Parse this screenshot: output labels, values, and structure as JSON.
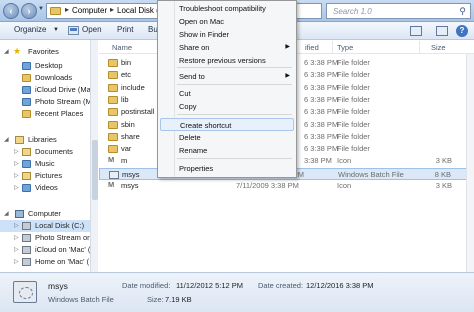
{
  "address_bar": {
    "segments": [
      "Computer",
      "Local Disk (C:)"
    ],
    "search_placeholder": "Search 1.0"
  },
  "toolbar": {
    "organize": "Organize",
    "open": "Open",
    "print": "Print",
    "burn": "Bu"
  },
  "sidebar": {
    "favorites": "Favorites",
    "fav_items": [
      "Desktop",
      "Downloads",
      "iCloud Drive (Ma",
      "Photo Stream (M",
      "Recent Places"
    ],
    "libraries": "Libraries",
    "lib_items": [
      "Documents",
      "Music",
      "Pictures",
      "Videos"
    ],
    "computer": "Computer",
    "comp_items": [
      "Local Disk (C:)",
      "Photo Stream on",
      "iCloud on 'Mac' (",
      "Home on 'Mac' ("
    ]
  },
  "list": {
    "columns": {
      "name": "Name",
      "modified": "ified",
      "type": "Type",
      "size": "Size"
    },
    "rows": [
      {
        "name": "bin",
        "modified": "6 3:38 PM",
        "type": "File folder",
        "size": "",
        "icon": "folder-icon"
      },
      {
        "name": "etc",
        "modified": "6 3:38 PM",
        "type": "File folder",
        "size": "",
        "icon": "folder-icon"
      },
      {
        "name": "include",
        "modified": "6 3:38 PM",
        "type": "File folder",
        "size": "",
        "icon": "folder-icon"
      },
      {
        "name": "lib",
        "modified": "6 3:38 PM",
        "type": "File folder",
        "size": "",
        "icon": "folder-icon"
      },
      {
        "name": "postinstall",
        "modified": "6 3:38 PM",
        "type": "File folder",
        "size": "",
        "icon": "folder-icon"
      },
      {
        "name": "sbin",
        "modified": "6 3:38 PM",
        "type": "File folder",
        "size": "",
        "icon": "folder-icon"
      },
      {
        "name": "share",
        "modified": "6 3:38 PM",
        "type": "File folder",
        "size": "",
        "icon": "folder-icon"
      },
      {
        "name": "var",
        "modified": "6 3:38 PM",
        "type": "File folder",
        "size": "",
        "icon": "folder-icon"
      },
      {
        "name": "m",
        "modified": "3:38 PM",
        "type": "Icon",
        "size": "3 KB",
        "icon": "msys-icon"
      },
      {
        "name": "msys",
        "modified": "11/12/2012 5:12 PM",
        "type": "Windows Batch File",
        "size": "8 KB",
        "icon": "batch-file-icon",
        "selected": true
      },
      {
        "name": "msys",
        "modified": "7/11/2009 3:38 PM",
        "type": "Icon",
        "size": "3 KB",
        "icon": "msys-icon"
      }
    ]
  },
  "status": {
    "name": "msys",
    "type": "Windows Batch File",
    "date_modified_label": "Date modified:",
    "date_modified": "11/12/2012 5:12 PM",
    "date_created_label": "Date created:",
    "date_created": "12/12/2016 3:38 PM",
    "size_label": "Size:",
    "size": "7.19 KB"
  },
  "context_menu": {
    "items": [
      {
        "label": "Troubleshoot compatibility"
      },
      {
        "label": "Open on Mac"
      },
      {
        "label": "Show in Finder"
      },
      {
        "label": "Share on",
        "submenu": true
      },
      {
        "label": "Restore previous versions"
      },
      {
        "label": "Send to",
        "submenu": true
      },
      {
        "label": "Cut"
      },
      {
        "label": "Copy"
      },
      {
        "label": "Create shortcut",
        "highlight": true
      },
      {
        "label": "Delete"
      },
      {
        "label": "Rename"
      },
      {
        "label": "Properties"
      }
    ]
  }
}
